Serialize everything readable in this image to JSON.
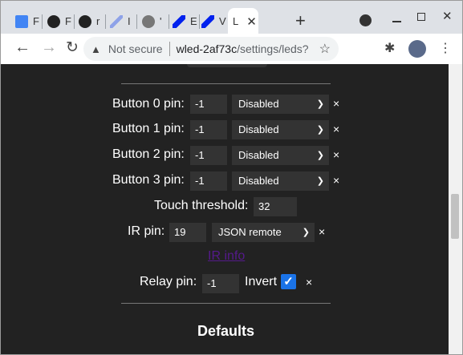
{
  "browser": {
    "tabs": [
      {
        "label": "F",
        "icon": "docs-icon"
      },
      {
        "label": "F",
        "icon": "github-icon"
      },
      {
        "label": "r",
        "icon": "github-icon"
      },
      {
        "label": "I",
        "icon": "wled-icon"
      },
      {
        "label": "'",
        "icon": "globe-icon"
      },
      {
        "label": "E",
        "icon": "wled-icon"
      },
      {
        "label": "V",
        "icon": "wled-icon"
      },
      {
        "label": "L",
        "icon": "",
        "active": true
      }
    ],
    "new_tab": "+",
    "security": "Not secure",
    "url_host": "wled-2af73c",
    "url_path": "/settings/leds?"
  },
  "page": {
    "buttons": [
      {
        "label": "Button 0 pin:",
        "pin": "-1",
        "type": "Disabled"
      },
      {
        "label": "Button 1 pin:",
        "pin": "-1",
        "type": "Disabled"
      },
      {
        "label": "Button 2 pin:",
        "pin": "-1",
        "type": "Disabled"
      },
      {
        "label": "Button 3 pin:",
        "pin": "-1",
        "type": "Disabled"
      }
    ],
    "touch_label": "Touch threshold:",
    "touch_value": "32",
    "ir_label": "IR pin:",
    "ir_pin": "19",
    "ir_type": "JSON remote",
    "ir_info": "IR info",
    "relay_label": "Relay pin:",
    "relay_pin": "-1",
    "invert_label": "Invert",
    "invert_checked": true,
    "remove": "×",
    "defaults_heading": "Defaults"
  },
  "colors": {
    "accent": "#1a73e8",
    "bg": "#222222",
    "link": "#551a8b"
  }
}
